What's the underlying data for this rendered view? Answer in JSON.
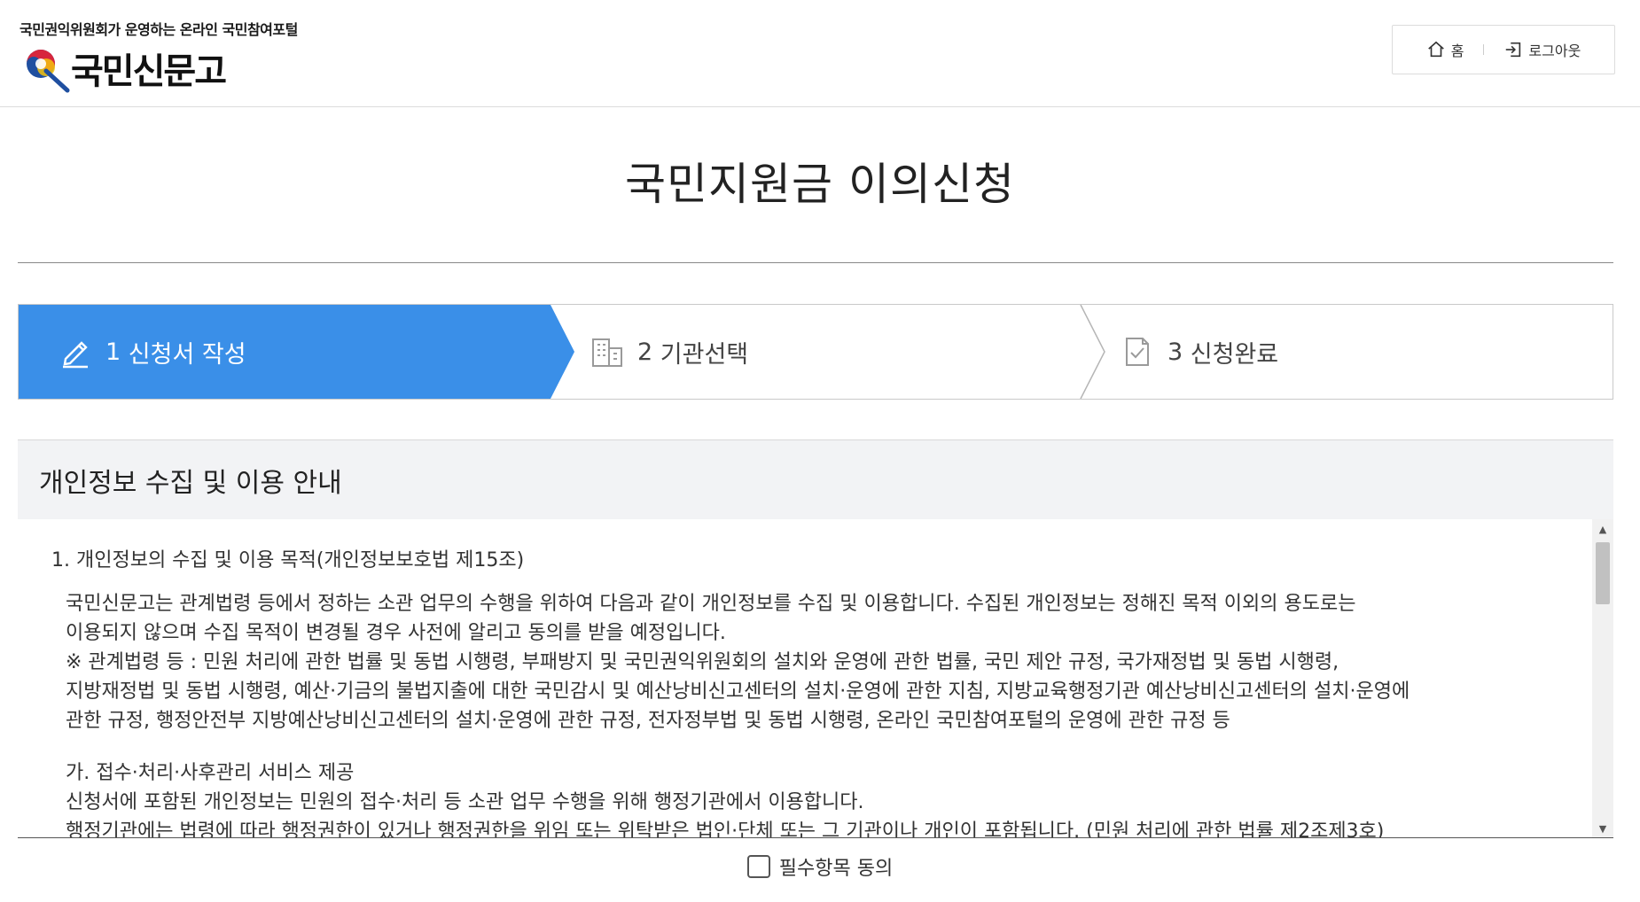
{
  "header": {
    "tagline": "국민권익위원회가 운영하는 온라인 국민참여포털",
    "logo_name": "국민신문고",
    "home_label": "홈",
    "logout_label": "로그아웃"
  },
  "page_title": "국민지원금 이의신청",
  "steps": [
    {
      "number": "1",
      "label": "신청서 작성",
      "active": true,
      "icon": "pencil-icon"
    },
    {
      "number": "2",
      "label": "기관선택",
      "active": false,
      "icon": "building-icon"
    },
    {
      "number": "3",
      "label": "신청완료",
      "active": false,
      "icon": "document-check-icon"
    }
  ],
  "privacy": {
    "heading": "개인정보 수집 및 이용 안내",
    "item1_title": "1. 개인정보의 수집 및 이용 목적(개인정보보호법 제15조)",
    "item1_lines": [
      "국민신문고는 관계법령 등에서 정하는 소관 업무의 수행을 위하여 다음과 같이 개인정보를 수집 및 이용합니다. 수집된 개인정보는 정해진 목적 이외의 용도로는",
      "이용되지 않으며 수집 목적이 변경될 경우 사전에 알리고 동의를 받을 예정입니다.",
      "※ 관계법령 등 : 민원 처리에 관한 법률 및 동법 시행령, 부패방지 및 국민권익위원회의 설치와 운영에 관한 법률, 국민 제안 규정, 국가재정법 및 동법 시행령,",
      "지방재정법 및 동법 시행령, 예산·기금의 불법지출에 대한 국민감시 및 예산낭비신고센터의 설치·운영에 관한 지침, 지방교육행정기관 예산낭비신고센터의 설치·운영에",
      "관한 규정, 행정안전부 지방예산낭비신고센터의 설치·운영에 관한 규정, 전자정부법 및 동법 시행령, 온라인 국민참여포털의 운영에 관한 규정 등"
    ],
    "sub_a_title": "가. 접수·처리·사후관리 서비스 제공",
    "sub_a_lines": [
      "신청서에 포함된 개인정보는 민원의 접수·처리 등 소관 업무 수행을 위해 행정기관에서 이용합니다.",
      "행정기관에는 법령에 따라 행정권한이 있거나 행정권한을 위임 또는 위탁받은 법인·단체 또는 그 기관이나 개인이 포함됩니다. (민원 처리에 관한 법률 제2조제3호)"
    ]
  },
  "consent_label": "필수항목 동의",
  "colors": {
    "active_step": "#3a8fe8",
    "section_head_bg": "#f2f3f5",
    "logo_red": "#d7263d",
    "logo_blue": "#1f4fa0",
    "logo_yellow": "#f4c20d"
  }
}
